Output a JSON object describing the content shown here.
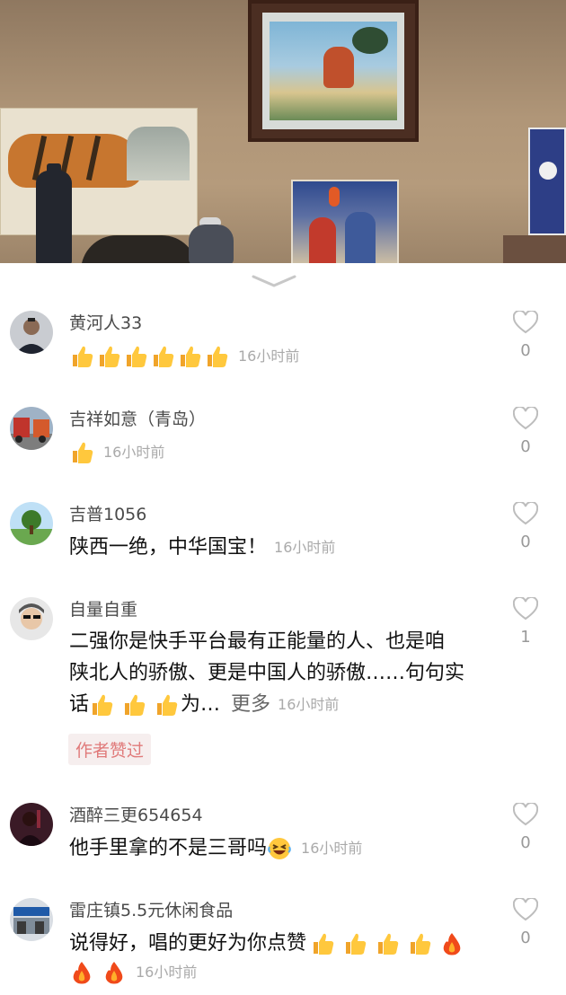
{
  "comments": [
    {
      "username": "黄河人33",
      "text": "",
      "thumbs": 6,
      "fire": 0,
      "time": "16小时前",
      "likes": "0"
    },
    {
      "username": "吉祥如意（青岛）",
      "text": "",
      "thumbs": 1,
      "fire": 0,
      "time": "16小时前",
      "likes": "0"
    },
    {
      "username": "吉普1056",
      "text": "陕西一绝，中华国宝！",
      "thumbs": 0,
      "fire": 0,
      "time": "16小时前",
      "likes": "0"
    },
    {
      "username": "自量自重",
      "lines": [
        "二强你是快手平台最有正能量的人、也是咱",
        "陕北人的骄傲、更是中国人的骄傲……句句实"
      ],
      "line3_prefix": "话",
      "line3_suffix": "为…",
      "more": "更多",
      "thumbs": 3,
      "time": "16小时前",
      "likes": "1",
      "author_badge": "作者赞过"
    },
    {
      "username": "酒醉三更654654",
      "text": "他手里拿的不是三哥吗",
      "emoji": "laughing-emoji",
      "time": "16小时前",
      "likes": "0"
    },
    {
      "username": "雷庄镇5.5元休闲食品",
      "text": "说得好，唱的更好为你点赞",
      "thumbs": 4,
      "fire": 3,
      "time": "16小时前",
      "likes": "0"
    }
  ],
  "icons": {
    "like": "heart-outline-icon",
    "collapse": "chevron-down-icon",
    "thumb": "thumbs-up-emoji",
    "fire": "fire-emoji"
  },
  "colors": {
    "accent_badge_bg": "#f6eeee",
    "accent_badge_text": "#e07a7a",
    "time": "#aaaaaa"
  }
}
